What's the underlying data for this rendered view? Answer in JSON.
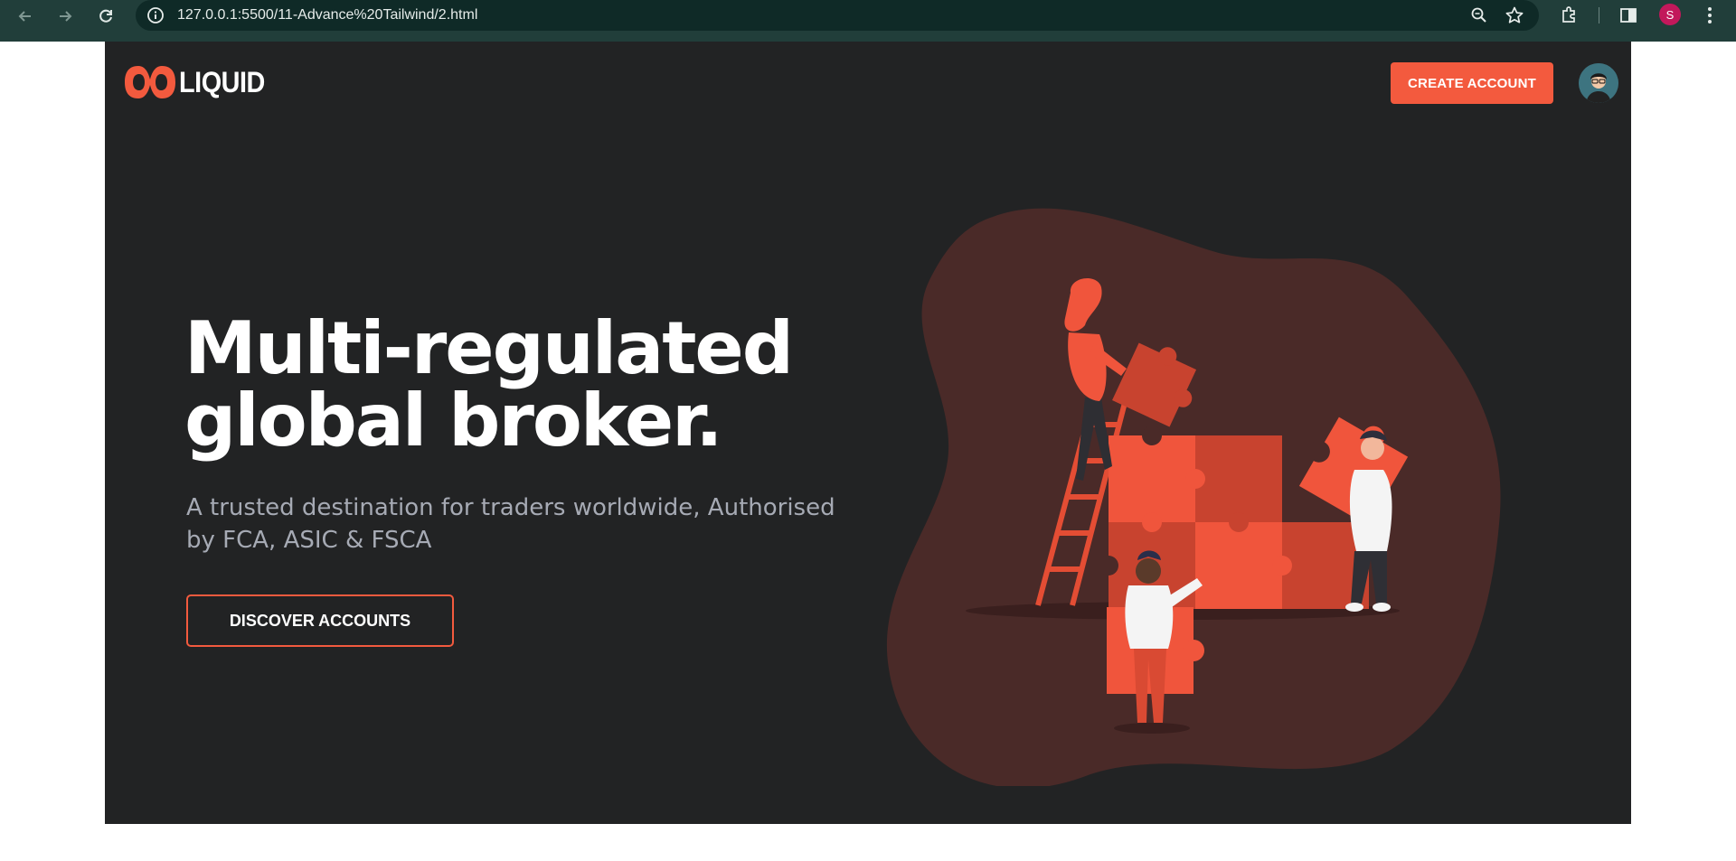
{
  "browser": {
    "url": "127.0.0.1:5500/11-Advance%20Tailwind/2.html",
    "profile_initial": "S"
  },
  "header": {
    "logo_text": "LIQUID",
    "create_account_label": "CREATE ACCOUNT"
  },
  "hero": {
    "title_line1": "Multi-regulated",
    "title_line2": "global broker.",
    "subtitle": "A trusted destination for traders worldwide, Authorised by FCA, ASIC & FSCA",
    "cta_label": "DISCOVER ACCOUNTS"
  },
  "colors": {
    "accent": "#f35a3e",
    "page_bg": "#222324",
    "chrome_bg": "#213e3a",
    "blob": "#4a2a28"
  },
  "icons": [
    "back-icon",
    "forward-icon",
    "reload-icon",
    "site-info-icon",
    "zoom-icon",
    "star-icon",
    "extensions-icon",
    "side-panel-icon",
    "menu-icon"
  ]
}
